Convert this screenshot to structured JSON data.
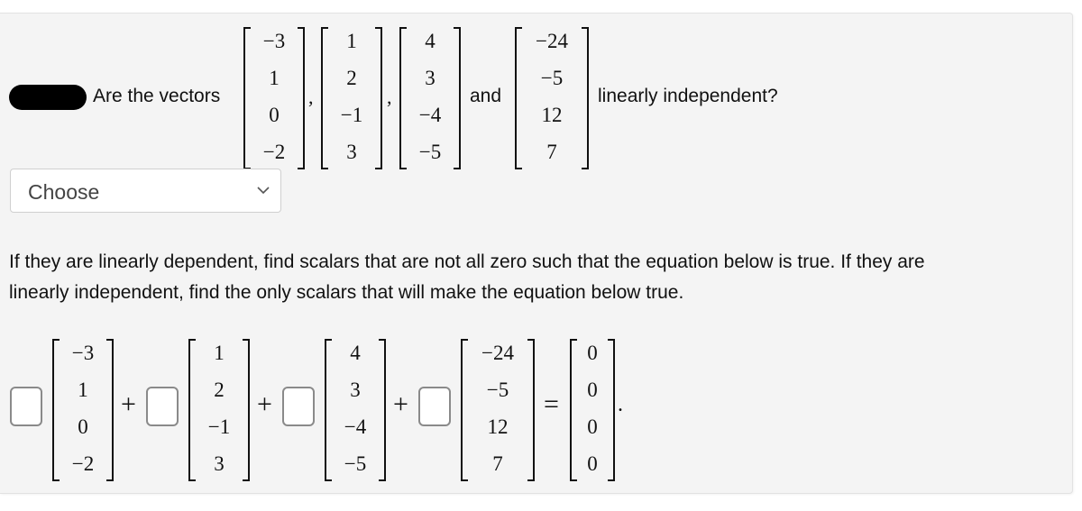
{
  "question": {
    "prefix": "Are the vectors",
    "comma": ",",
    "and": "and",
    "suffix": "linearly independent?",
    "vectors": [
      [
        "−3",
        "1",
        "0",
        "−2"
      ],
      [
        "1",
        "2",
        "−1",
        "3"
      ],
      [
        "4",
        "3",
        "−4",
        "−5"
      ],
      [
        "−24",
        "−5",
        "12",
        "7"
      ]
    ]
  },
  "dropdown": {
    "selected": "Choose"
  },
  "instructions": {
    "line1": "If they are linearly dependent, find scalars that are not all zero such that the equation below is true. If they are",
    "line2": "linearly independent, find the only scalars that will make the equation below true."
  },
  "equation": {
    "plus": "+",
    "equals": "=",
    "period": ".",
    "scalars": [
      "",
      "",
      "",
      ""
    ],
    "vectors": [
      [
        "−3",
        "1",
        "0",
        "−2"
      ],
      [
        "1",
        "2",
        "−1",
        "3"
      ],
      [
        "4",
        "3",
        "−4",
        "−5"
      ],
      [
        "−24",
        "−5",
        "12",
        "7"
      ]
    ],
    "zero_vector": [
      "0",
      "0",
      "0",
      "0"
    ]
  }
}
